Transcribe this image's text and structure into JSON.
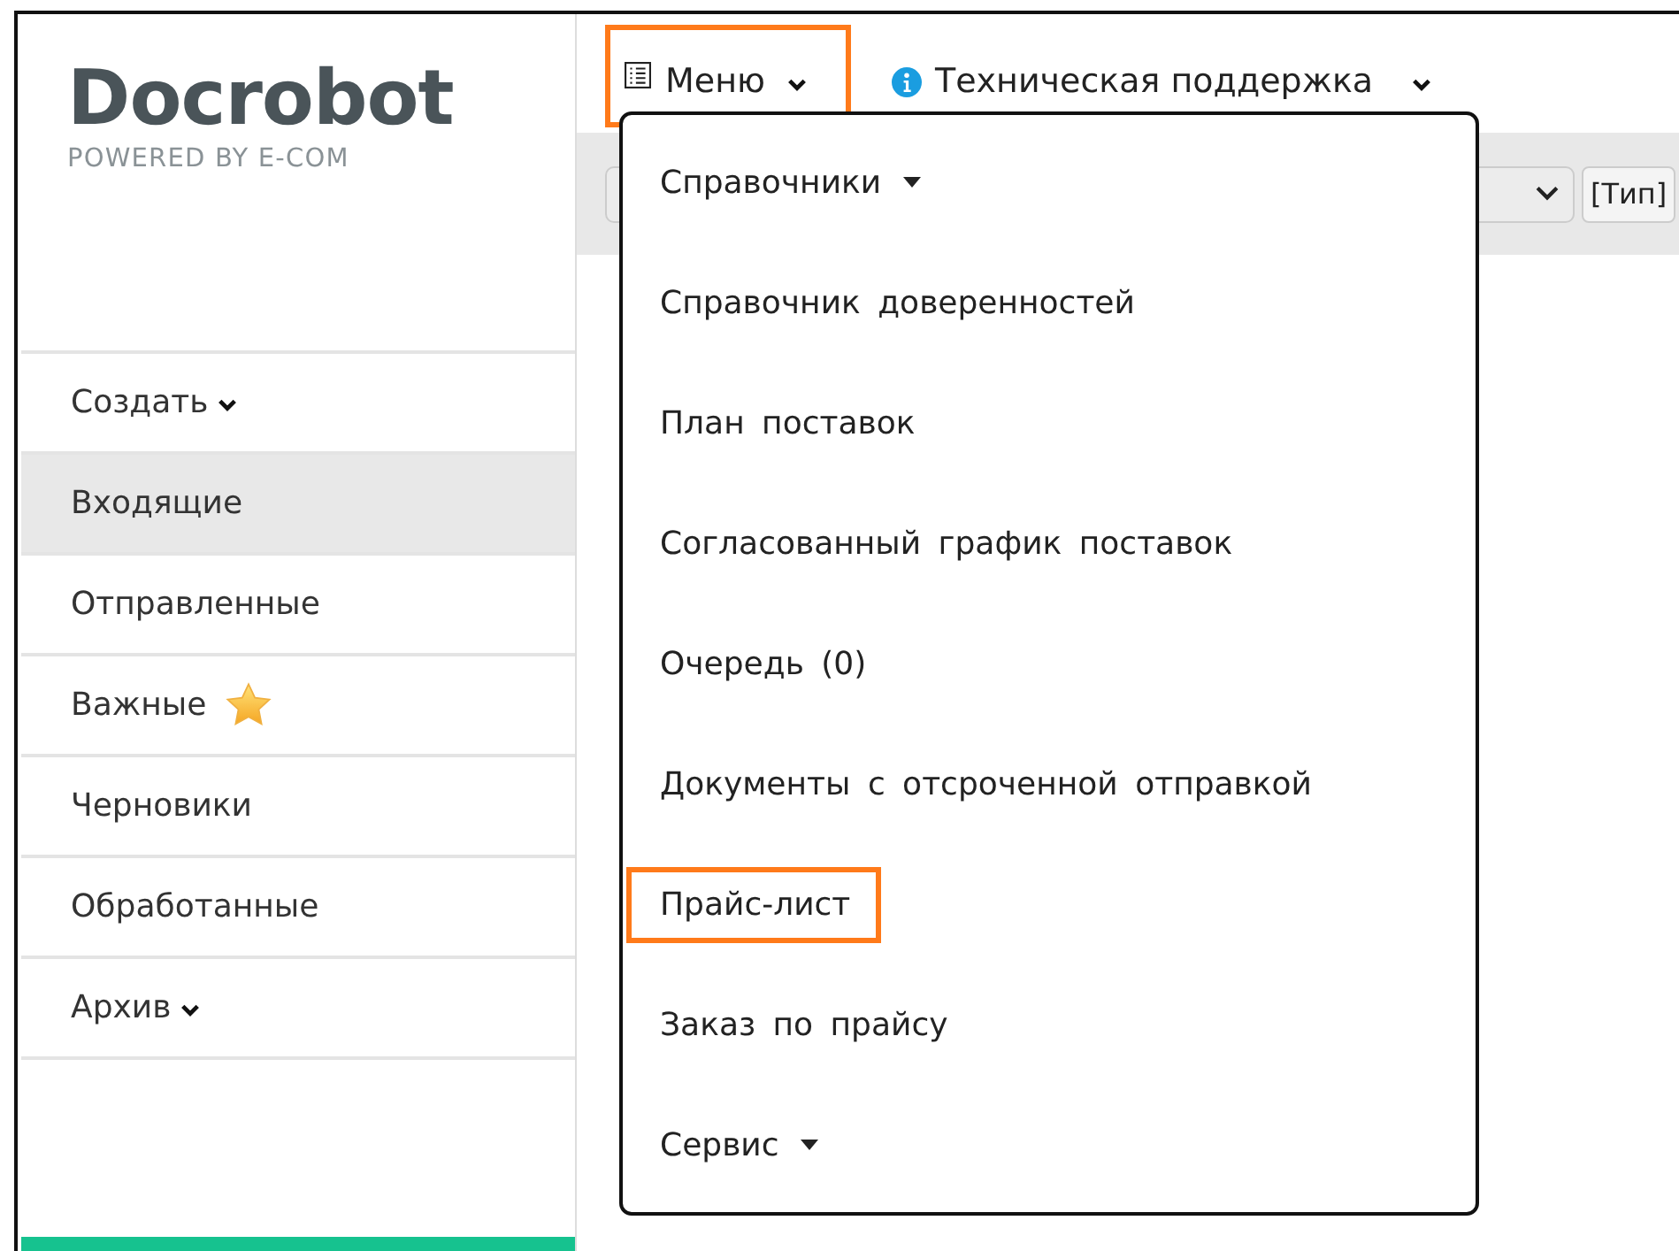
{
  "logo": {
    "name": "Docrobot",
    "tagline": "POWERED BY E-COM"
  },
  "sidebar": {
    "items": [
      {
        "label": "Создать",
        "kind": "dropdown",
        "selected": false
      },
      {
        "label": "Входящие",
        "kind": "plain",
        "selected": true
      },
      {
        "label": "Отправленные",
        "kind": "plain",
        "selected": false
      },
      {
        "label": "Важные",
        "kind": "starred",
        "selected": false
      },
      {
        "label": "Черновики",
        "kind": "plain",
        "selected": false
      },
      {
        "label": "Обработанные",
        "kind": "plain",
        "selected": false
      },
      {
        "label": "Архив",
        "kind": "dropdown",
        "selected": false
      }
    ]
  },
  "top_nav": [
    {
      "label": "Меню",
      "kind": "menu",
      "highlighted": true
    },
    {
      "label": "Техническая поддержка",
      "kind": "info",
      "highlighted": false
    }
  ],
  "toolbar": {
    "button": "[Тип]"
  },
  "menu": {
    "items": [
      {
        "label": "Справочники",
        "kind": "submenu",
        "highlighted": false
      },
      {
        "label": "Справочник доверенностей",
        "kind": "plain",
        "highlighted": false
      },
      {
        "label": "План поставок",
        "kind": "plain",
        "highlighted": false
      },
      {
        "label": "Согласованный график поставок",
        "kind": "plain",
        "highlighted": false
      },
      {
        "label": "Очередь (0)",
        "kind": "plain",
        "highlighted": false
      },
      {
        "label": "Документы с отсроченной отправкой",
        "kind": "plain",
        "highlighted": false
      },
      {
        "label": "Прайс-лист",
        "kind": "plain",
        "highlighted": true
      },
      {
        "label": "Заказ по прайсу",
        "kind": "plain",
        "highlighted": false
      },
      {
        "label": "Сервис",
        "kind": "submenu",
        "highlighted": false
      }
    ]
  }
}
